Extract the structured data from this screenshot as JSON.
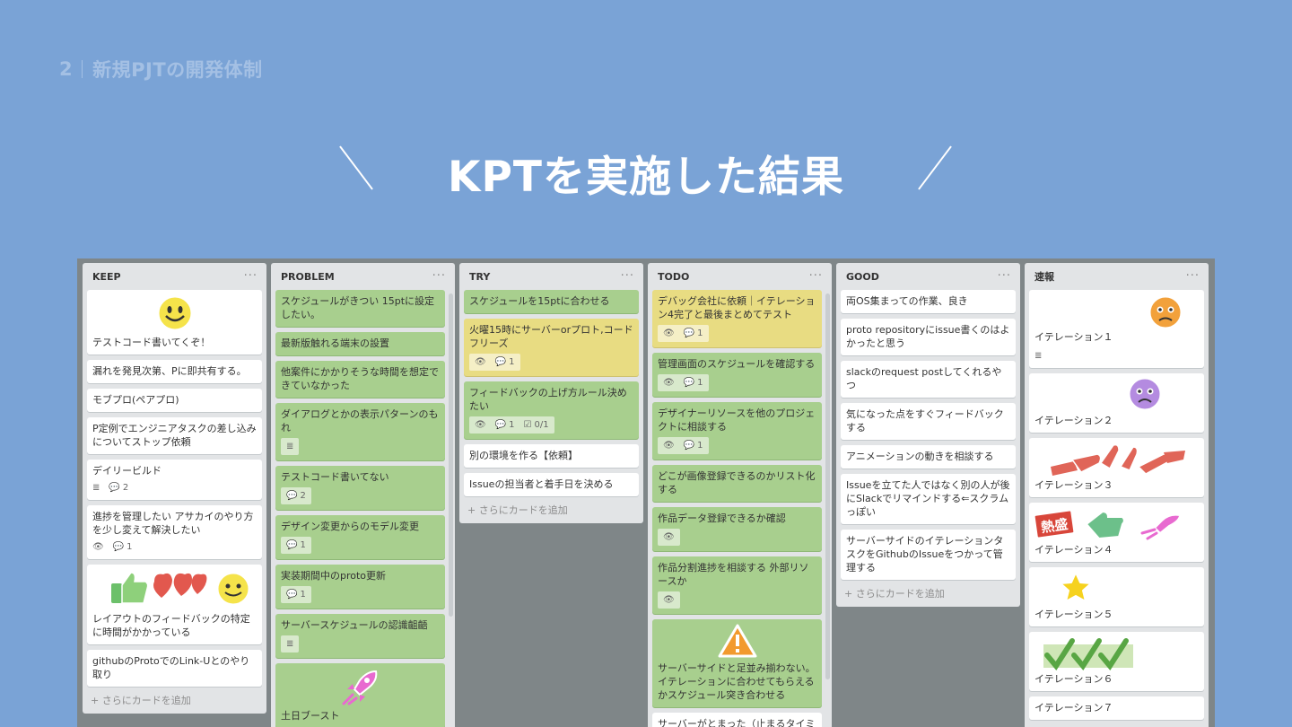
{
  "header": {
    "page_number": "2",
    "section": "新規PJTの開発体制",
    "headline": "KPTを実施した結果"
  },
  "board": {
    "add_card_label": "+ さらにカードを追加",
    "menu_glyph": "···",
    "lists": {
      "keep": {
        "title": "KEEP",
        "cards": {
          "c0": {
            "text": "テストコード書いてくぞ！",
            "sticker": "smiley-icon"
          },
          "c1": {
            "text": "漏れを発見次第、Pに即共有する。"
          },
          "c2": {
            "text": "モブプロ(ペアプロ)"
          },
          "c3": {
            "text": "P定例でエンジニアタスクの差し込みについてストップ依頼"
          },
          "c4": {
            "text": "デイリービルド",
            "comments": "2"
          },
          "c5": {
            "text": "進捗を管理したい アサカイのやり方を少し変えて解決したい",
            "comments": "1"
          },
          "c6": {
            "text": "レイアウトのフィードバックの特定に時間がかかっている",
            "sticker": "thumbsup-hearts-smiley-icon"
          },
          "c7": {
            "text": "githubのProtoでのLink-Uとのやり取り"
          }
        }
      },
      "problem": {
        "title": "PROBLEM",
        "cards": {
          "c0": {
            "text": "スケジュールがきつい 15ptに設定したい。"
          },
          "c1": {
            "text": "最新版触れる端末の設置"
          },
          "c2": {
            "text": "他案件にかかりそうな時間を想定できていなかった"
          },
          "c3": {
            "text": "ダイアログとかの表示パターンのもれ"
          },
          "c4": {
            "text": "テストコード書いてない",
            "comments": "2"
          },
          "c5": {
            "text": "デザイン変更からのモデル変更",
            "comments": "1"
          },
          "c6": {
            "text": "実装期間中のproto更新",
            "comments": "1"
          },
          "c7": {
            "text": "サーバースケジュールの認識齟齬"
          },
          "c8": {
            "text": "土日ブースト",
            "sticker": "rocket-icon"
          }
        }
      },
      "try": {
        "title": "TRY",
        "cards": {
          "c0": {
            "text": "スケジュールを15ptに合わせる"
          },
          "c1": {
            "text": "火曜15時にサーバーorプロト,コードフリーズ",
            "comments": "1"
          },
          "c2": {
            "text": "フィードバックの上げ方ルール決めたい",
            "comments": "1",
            "checklist": "0/1"
          },
          "c3": {
            "text": "別の環境を作る【依頼】"
          },
          "c4": {
            "text": "Issueの担当者と着手日を決める"
          }
        }
      },
      "todo": {
        "title": "TODO",
        "cards": {
          "c0": {
            "text": "デバッグ会社に依頼｜イテレーション4完了と最後まとめてテスト",
            "comments": "1"
          },
          "c1": {
            "text": "管理画面のスケジュールを確認する",
            "comments": "1"
          },
          "c2": {
            "text": "デザイナーリソースを他のプロジェクトに相談する",
            "comments": "1"
          },
          "c3": {
            "text": "どこが画像登録できるのかリスト化する"
          },
          "c4": {
            "text": "作品データ登録できるか確認"
          },
          "c5": {
            "text": "作品分割進捗を相談する 外部リソースか"
          },
          "c6": {
            "text": "サーバーサイドと足並み揃わない。イテレーションに合わせてもらえるかスケジュール突き合わせる",
            "sticker": "warning-icon"
          },
          "c7": {
            "text": "サーバーがとまった（止まるタイミ"
          }
        }
      },
      "good": {
        "title": "GOOD",
        "cards": {
          "c0": {
            "text": "両OS集まっての作業、良き"
          },
          "c1": {
            "text": "proto repositoryにissue書くのはよかったと思う"
          },
          "c2": {
            "text": "slackのrequest postしてくれるやつ"
          },
          "c3": {
            "text": "気になった点をすぐフィードバックする"
          },
          "c4": {
            "text": "アニメーションの動きを相談する"
          },
          "c5": {
            "text": "Issueを立てた人ではなく別の人が後にSlackでリマインドする⇐スクラムっぽい"
          },
          "c6": {
            "text": "サーバーサイドのイテレーションタスクをGithubのIssueをつかって管理する"
          }
        }
      },
      "news": {
        "title": "速報",
        "cards": {
          "c0": {
            "text": "イテレーション１",
            "sticker": "worried-face-icon"
          },
          "c1": {
            "text": "イテレーション２",
            "sticker": "sad-face-icon"
          },
          "c2": {
            "text": "イテレーション３",
            "sticker": "pointing-hands-icon"
          },
          "c3": {
            "text": "イテレーション４",
            "sticker": "hot-stamp-thumb-rocket-icon",
            "stamp_text": "熱盛"
          },
          "c4": {
            "text": "イテレーション５",
            "sticker": "star-icon"
          },
          "c5": {
            "text": "イテレーション６",
            "sticker": "checkmarks-icon"
          },
          "c6": {
            "text": "イテレーション７"
          }
        }
      }
    }
  },
  "colors": {
    "background": "#7aa3d6",
    "board": "#7f8688",
    "list": "#e2e4e6",
    "card_green": "#a8cf8e",
    "card_yellow": "#e8dc82",
    "card_white": "#ffffff"
  }
}
